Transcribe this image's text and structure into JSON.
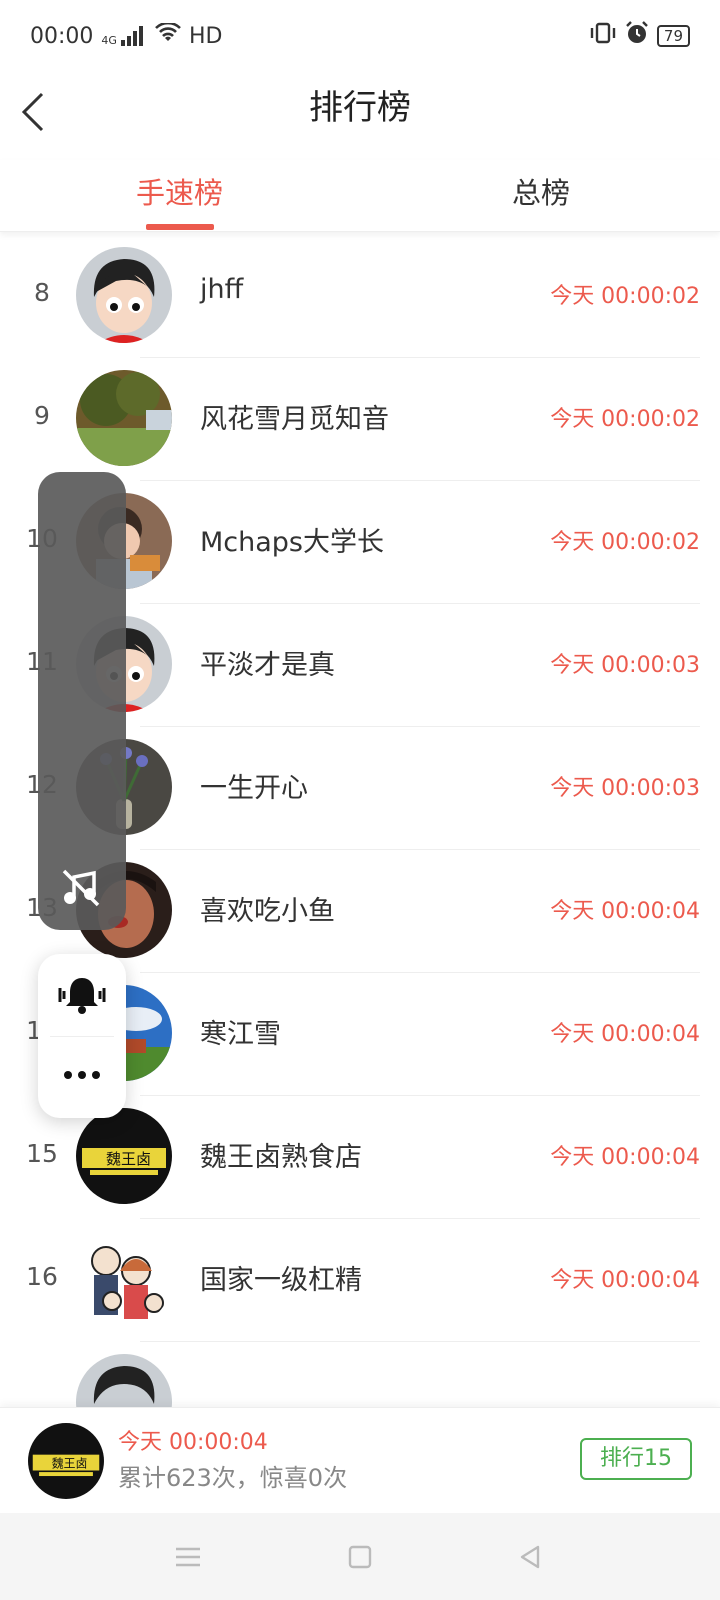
{
  "status_bar": {
    "time": "00:00",
    "signal": "4G",
    "hd": "HD",
    "battery": "79"
  },
  "header": {
    "title": "排行榜"
  },
  "tabs": [
    {
      "label": "手速榜"
    },
    {
      "label": "总榜"
    }
  ],
  "rows": [
    {
      "rank": "8",
      "name": "jhff",
      "time": "今天 00:00:02"
    },
    {
      "rank": "9",
      "name": "风花雪月觅知音",
      "time": "今天 00:00:02"
    },
    {
      "rank": "10",
      "name": "Mchaps大学长",
      "time": "今天 00:00:02"
    },
    {
      "rank": "11",
      "name": "平淡才是真",
      "time": "今天 00:00:03"
    },
    {
      "rank": "12",
      "name": "一生开心",
      "time": "今天 00:00:03"
    },
    {
      "rank": "13",
      "name": "喜欢吃小鱼",
      "time": "今天 00:00:04"
    },
    {
      "rank": "14",
      "name": "寒江雪",
      "time": "今天 00:00:04"
    },
    {
      "rank": "15",
      "name": "魏王卤熟食店",
      "time": "今天 00:00:04"
    },
    {
      "rank": "16",
      "name": "国家一级杠精",
      "time": "今天 00:00:04"
    },
    {
      "rank": "",
      "name": "",
      "time": ""
    }
  ],
  "logo_text": "魏王卤",
  "my_record": {
    "time": "今天 00:00:04",
    "summary": "累计623次，惊喜0次",
    "rank_badge": "排行15"
  },
  "colors": {
    "accent": "#ec5a4d",
    "green": "#4caf50"
  }
}
